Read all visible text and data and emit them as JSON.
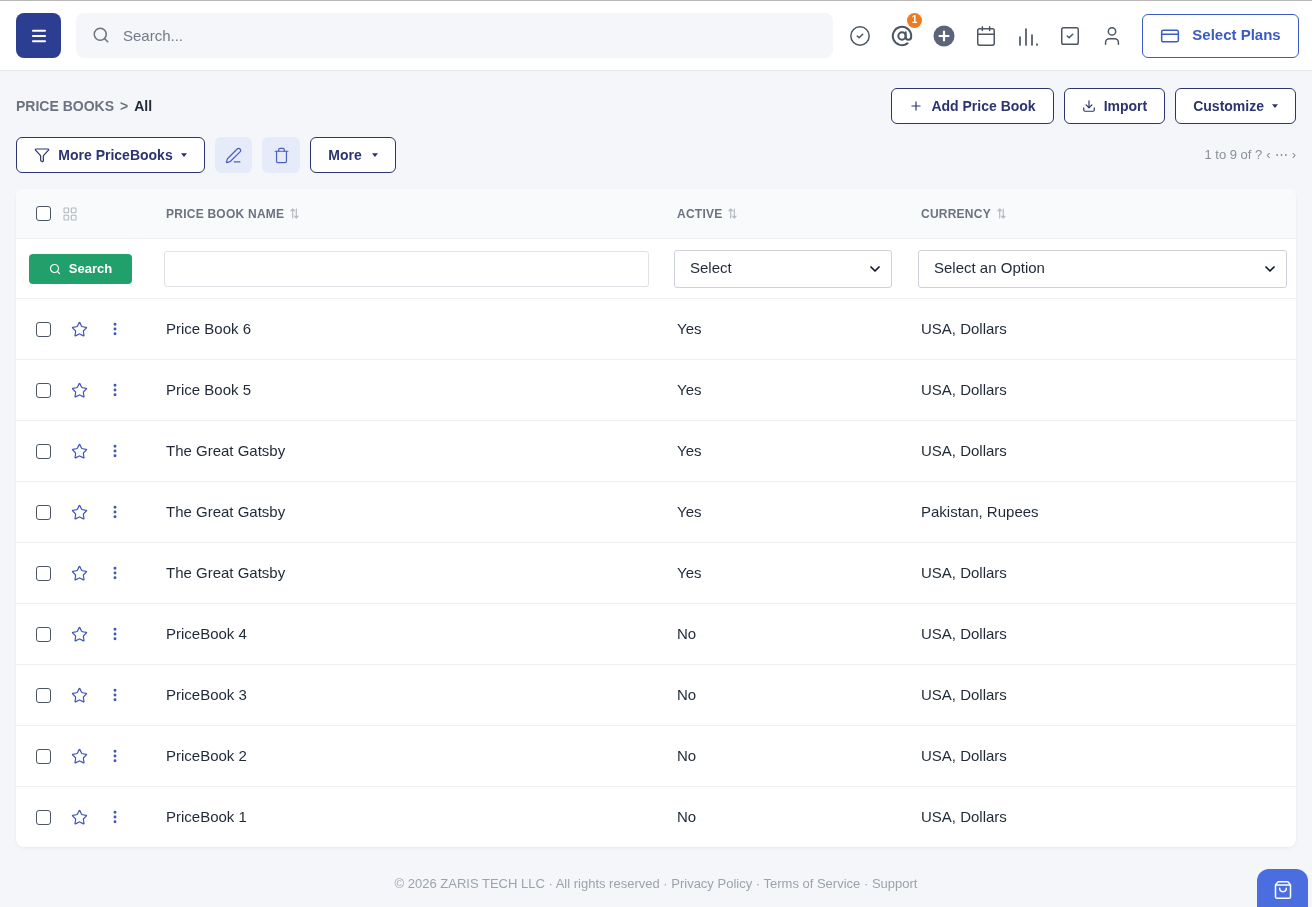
{
  "header": {
    "search": {
      "placeholder": "Search..."
    },
    "mentions_badge": "1",
    "plans_button": "Select Plans"
  },
  "breadcrumb": {
    "parent": "PRICE BOOKS",
    "separator": ">",
    "current": "All"
  },
  "actions": [
    {
      "kind": "add",
      "label": "Add Price Book"
    },
    {
      "kind": "import",
      "label": "Import"
    },
    {
      "kind": "dropdown",
      "label": "Customize"
    }
  ],
  "toolbar": {
    "filter_button": "More PriceBooks",
    "more_button": "More"
  },
  "pagination": {
    "range": "1 to 9 of ?",
    "prev": "‹",
    "more": "⋯",
    "next": "›"
  },
  "table": {
    "select_all_checked": false,
    "search_button": "Search",
    "columns": [
      {
        "label": "PRICE BOOK NAME",
        "filter": {
          "kind": "text"
        }
      },
      {
        "label": "ACTIVE",
        "filter": {
          "kind": "select",
          "value": "Select"
        }
      },
      {
        "label": "CURRENCY",
        "filter": {
          "kind": "select",
          "value": "Select an Option"
        }
      }
    ],
    "rows": [
      {
        "checked": false,
        "starred": false,
        "name": "Price Book 6",
        "active": "Yes",
        "currency": "USA, Dollars"
      },
      {
        "checked": false,
        "starred": false,
        "name": "Price Book 5",
        "active": "Yes",
        "currency": "USA, Dollars"
      },
      {
        "checked": false,
        "starred": false,
        "name": "The Great Gatsby",
        "active": "Yes",
        "currency": "USA, Dollars"
      },
      {
        "checked": false,
        "starred": false,
        "name": "The Great Gatsby",
        "active": "Yes",
        "currency": "Pakistan, Rupees"
      },
      {
        "checked": false,
        "starred": false,
        "name": "The Great Gatsby",
        "active": "Yes",
        "currency": "USA, Dollars"
      },
      {
        "checked": false,
        "starred": false,
        "name": "PriceBook 4",
        "active": "No",
        "currency": "USA, Dollars"
      },
      {
        "checked": false,
        "starred": false,
        "name": "PriceBook 3",
        "active": "No",
        "currency": "USA, Dollars"
      },
      {
        "checked": false,
        "starred": false,
        "name": "PriceBook 2",
        "active": "No",
        "currency": "USA, Dollars"
      },
      {
        "checked": false,
        "starred": false,
        "name": "PriceBook 1",
        "active": "No",
        "currency": "USA, Dollars"
      }
    ]
  },
  "footer": {
    "separator": "·",
    "notice": [
      "© 2026 ZARIS TECH LLC",
      "All rights reserved"
    ],
    "links": [
      "Privacy Policy",
      "Terms of Service",
      "Support"
    ]
  }
}
